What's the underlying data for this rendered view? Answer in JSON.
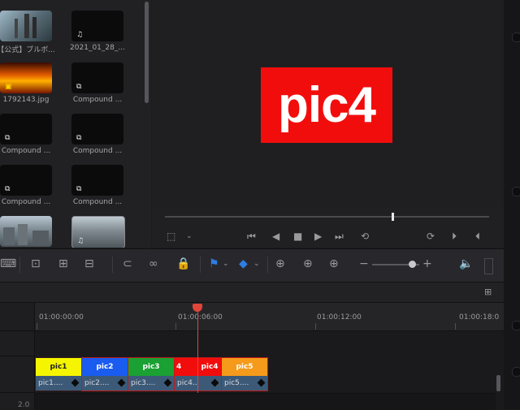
{
  "media_pool": {
    "clips": [
      {
        "label": "【公式】ブルボ...",
        "type": "video"
      },
      {
        "label": "2021_01_28_...",
        "type": "audio"
      },
      {
        "label": "1792143.jpg",
        "type": "image"
      },
      {
        "label": "Compound ...",
        "type": "compound"
      },
      {
        "label": "Compound ...",
        "type": "compound"
      },
      {
        "label": "Compound ...",
        "type": "compound"
      },
      {
        "label": "Compound ...",
        "type": "compound"
      },
      {
        "label": "Compound ...",
        "type": "compound"
      },
      {
        "label": "",
        "type": "video"
      },
      {
        "label": "",
        "type": "video-audio"
      }
    ]
  },
  "viewer": {
    "frame_text": "pic4",
    "frame_color": "#f20d0d"
  },
  "timeline": {
    "timecodes": [
      "01:00:00:00",
      "01:00:06:00",
      "01:00:12:00",
      "01:00:18:0"
    ],
    "clips": [
      {
        "title": "pic1",
        "label": "pic1....",
        "color": "#f5f500",
        "text_color": "#222"
      },
      {
        "title": "pic2",
        "label": "pic2....",
        "color": "#1a5bf0",
        "text_color": "#fff"
      },
      {
        "title": "pic3",
        "label": "pic3....",
        "color": "#1aa033",
        "text_color": "#fff"
      },
      {
        "title": "4",
        "label": "pic4....",
        "color": "#f20d0d",
        "text_color": "#fff"
      },
      {
        "title": "pic4",
        "label": "",
        "color": "#f20d0d",
        "text_color": "#fff"
      },
      {
        "title": "pic5",
        "label": "pic5....",
        "color": "#f59a1a",
        "text_color": "#fff"
      }
    ],
    "track_label": "2.0"
  },
  "icons": {
    "ripple": "ripple-icon",
    "link": "link-icon",
    "lock": "lock-icon",
    "flag": "flag-icon",
    "marker": "marker-icon",
    "zoom": "zoom-icon",
    "volume": "volume-icon"
  }
}
